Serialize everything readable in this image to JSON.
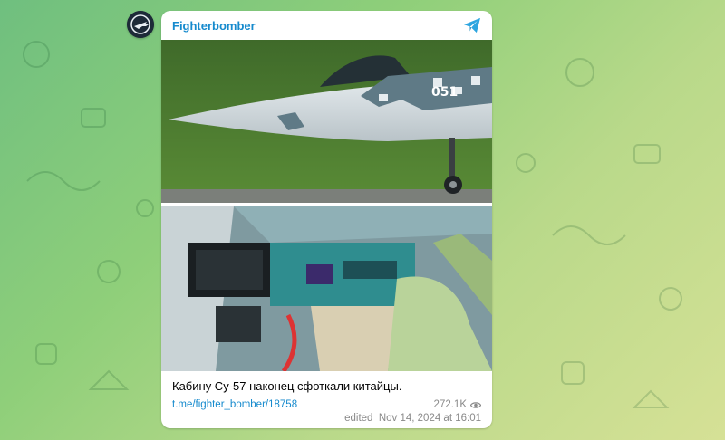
{
  "post": {
    "channel_name": "Fighterbomber",
    "caption": "Кабину Су-57 наконец сфоткали китайцы.",
    "link": "t.me/fighter_bomber/18758",
    "views": "272.1K",
    "edited_label": "edited",
    "date": "Nov 14, 2024 at 16:01",
    "aircraft_marking": "051"
  },
  "colors": {
    "accent": "#168acd",
    "meta": "#8a8a8a"
  },
  "icons": {
    "share": "paper-plane-icon",
    "views": "eye-icon"
  }
}
